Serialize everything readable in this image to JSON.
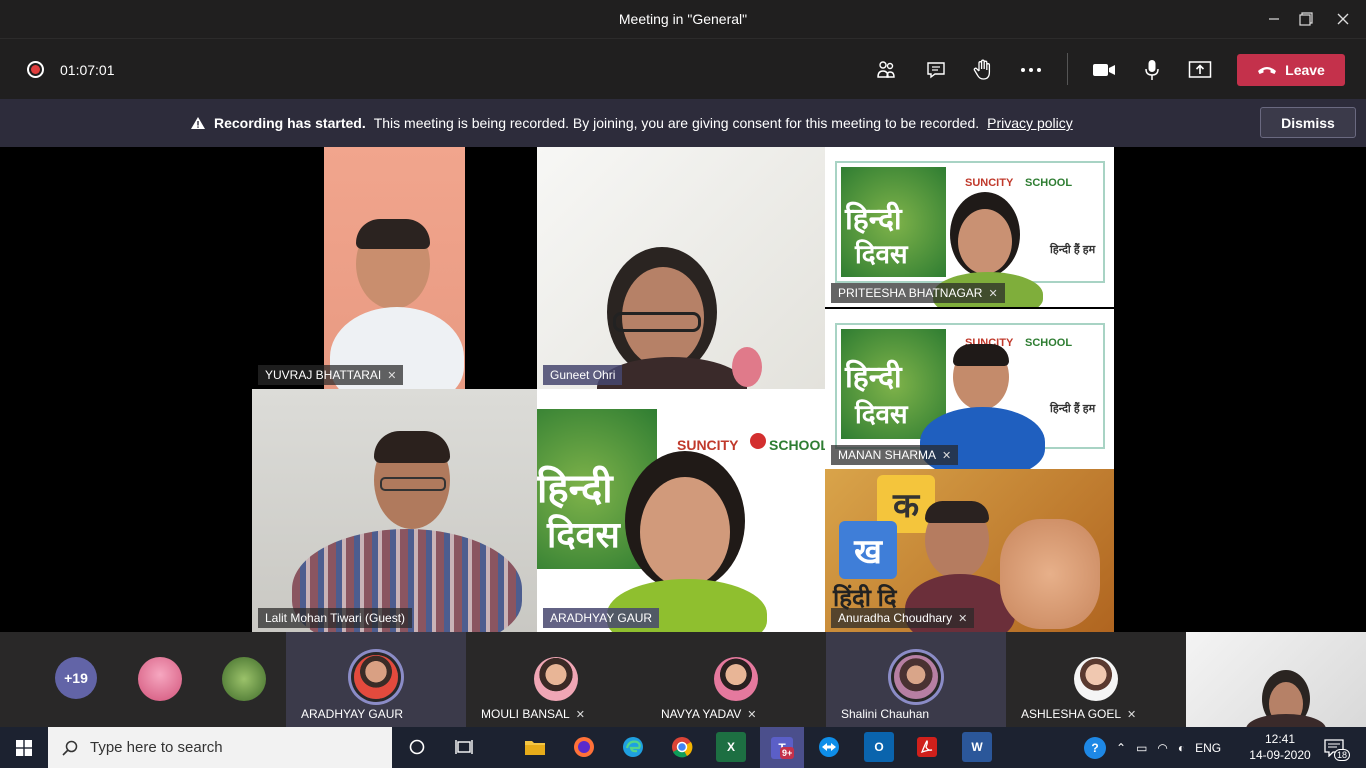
{
  "window": {
    "title": "Meeting in \"General\""
  },
  "toolbar": {
    "timer": "01:07:01",
    "leave_label": "Leave"
  },
  "banner": {
    "bold": "Recording has started.",
    "message": "This meeting is being recorded. By joining, you are giving consent for this meeting to be recorded.",
    "link": "Privacy policy",
    "dismiss_label": "Dismiss"
  },
  "tiles": {
    "yuvraj": "YUVRAJ BHATTARAI",
    "guneet": "Guneet Ohri",
    "priteesha": "PRITEESHA BHATNAGAR",
    "manan": "MANAN SHARMA",
    "lalit": "Lalit Mohan Tiwari (Guest)",
    "aradhyay": "ARADHYAY GAUR",
    "anuradha": "Anuradha Choudhary"
  },
  "backgrounds": {
    "school_name": "SUNCITY",
    "school_word": "SCHOOL",
    "hindi_title_1": "हिन्दी",
    "hindi_title_2": "दिवस",
    "hindi_tag": "हिन्दी हैं हम",
    "letter_ka": "क",
    "letter_kha": "ख",
    "hindi_bottom": "हिंदी दि"
  },
  "participants": {
    "more_count": "+19",
    "items": [
      {
        "name": "ARADHYAY GAUR",
        "muted": false
      },
      {
        "name": "MOULI BANSAL",
        "muted": true
      },
      {
        "name": "NAVYA YADAV",
        "muted": true
      },
      {
        "name": "Shalini Chauhan",
        "muted": false
      },
      {
        "name": "ASHLESHA GOEL",
        "muted": true
      }
    ]
  },
  "taskbar": {
    "search_placeholder": "Type here to search",
    "teams_badge": "9+",
    "language": "ENG",
    "time": "12:41",
    "date": "14-09-2020",
    "notifications": "18"
  },
  "colors": {
    "leave_red": "#c4314b",
    "accent_purple": "#6264a7",
    "record_red": "#e03e3e"
  }
}
